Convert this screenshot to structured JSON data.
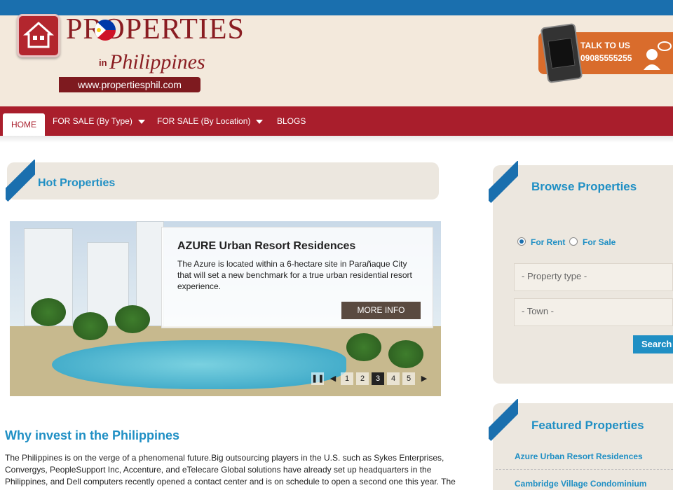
{
  "header": {
    "logo_title": "PROPERTIES",
    "logo_in": "in",
    "logo_subtitle": "Philippines",
    "logo_url": "www.propertiesphil.com",
    "talk_label": "TALK TO US",
    "talk_number": "09085555255"
  },
  "nav": {
    "items": [
      {
        "label": "HOME",
        "active": true
      },
      {
        "label": "FOR SALE (By Type)",
        "dropdown": true
      },
      {
        "label": "FOR SALE (By Location)",
        "dropdown": true
      },
      {
        "label": "BLOGS"
      }
    ]
  },
  "hot_properties": {
    "title": "Hot Properties",
    "slide": {
      "title": "AZURE Urban Resort Residences",
      "text": "The Azure is located within a 6-hectare site in Parañaque City that will set a new benchmark for a true urban residential resort experience.",
      "button": "MORE INFO"
    },
    "pager": {
      "pages": [
        "1",
        "2",
        "3",
        "4",
        "5"
      ],
      "current": "3"
    }
  },
  "why_invest": {
    "title": "Why invest in the Philippines",
    "text": "The Philippines is on the verge of a phenomenal future.Big outsourcing players in the U.S. such as Sykes Enterprises, Convergys, PeopleSupport Inc, Accenture, and eTelecare Global solutions have already set up headquarters in the Philippines, and Dell computers recently opened a contact center and is on schedule to open a second one this year. The"
  },
  "browse": {
    "title": "Browse Properties",
    "for_rent": "For Rent",
    "for_sale": "For Sale",
    "property_type_placeholder": "- Property type -",
    "town_placeholder": "- Town -",
    "search_label": "Search"
  },
  "featured": {
    "title": "Featured Properties",
    "items": [
      "Azure Urban Resort Residences",
      "Cambridge Village Condominium"
    ]
  },
  "colors": {
    "brand_red": "#a91e2c",
    "brand_blue": "#1a6fae",
    "accent_orange": "#d96c2c",
    "link_blue": "#1f8fc4"
  }
}
